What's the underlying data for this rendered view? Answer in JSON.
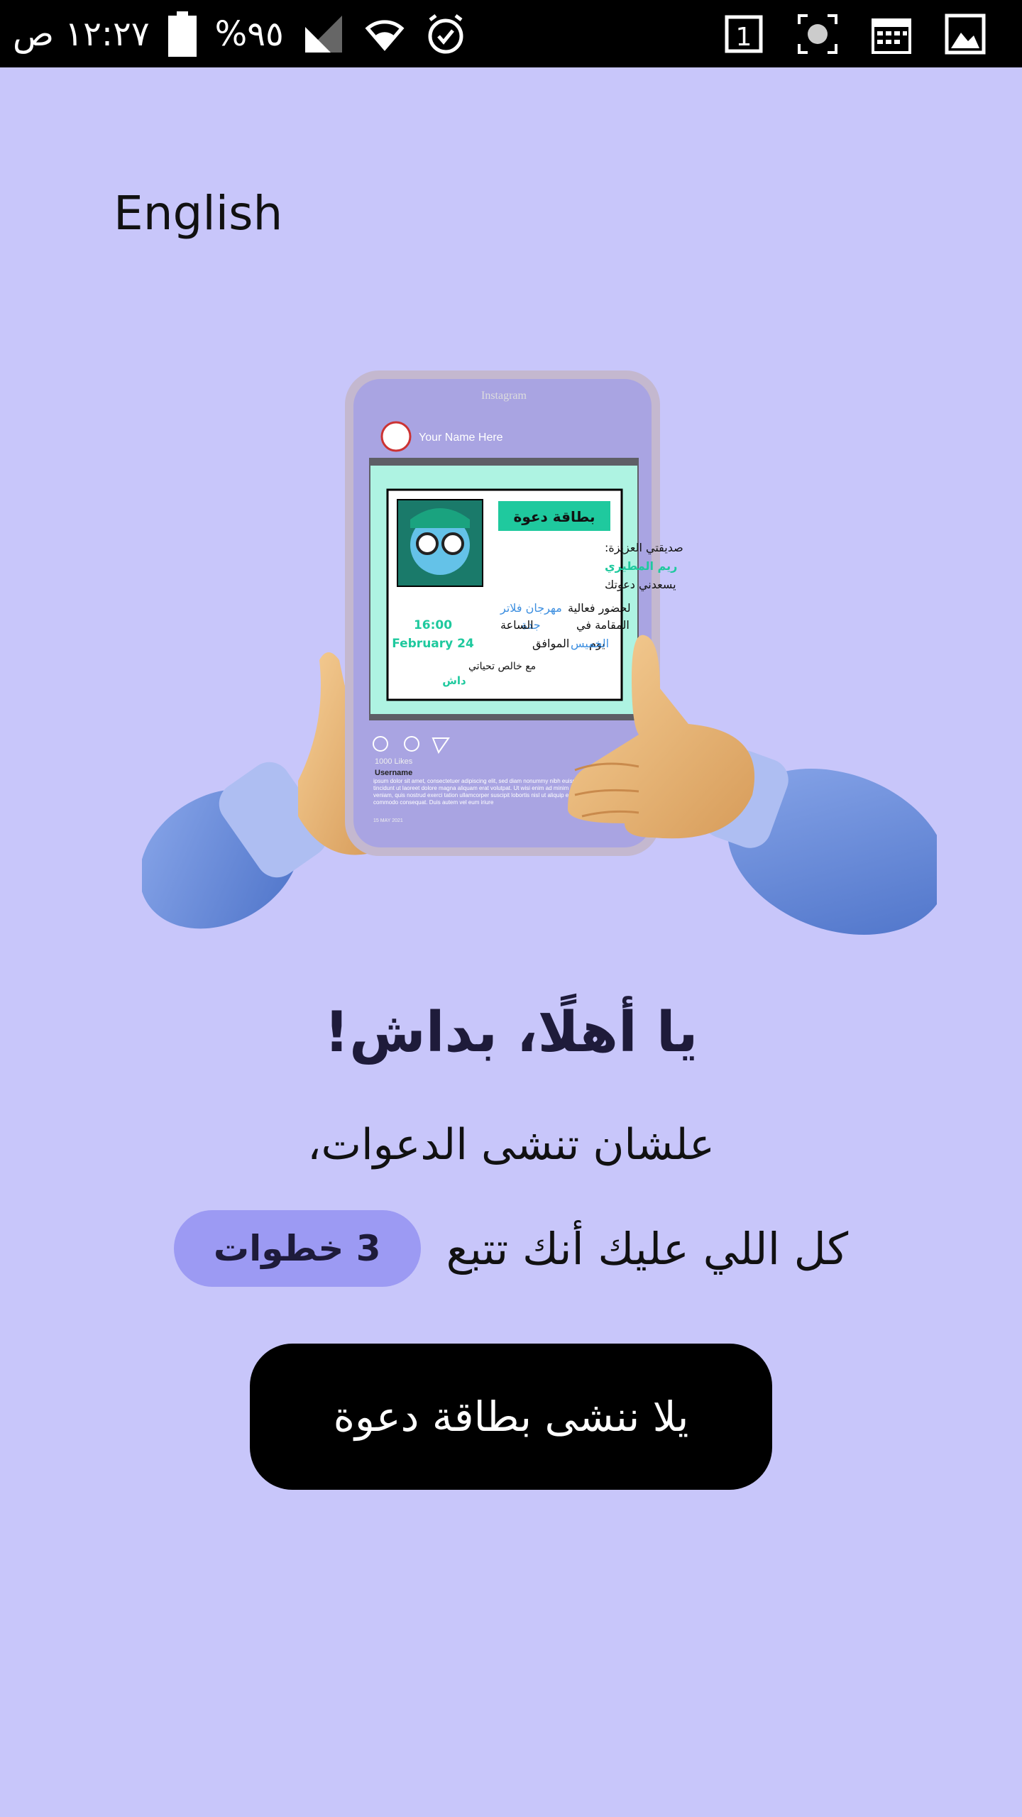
{
  "status_bar": {
    "time": "١٢:٢٧ ص",
    "battery": "%٩٥",
    "right_icons": [
      "sim-1-icon",
      "screenshot-icon",
      "calendar-icon",
      "gallery-icon"
    ]
  },
  "language_toggle": "English",
  "illustration": {
    "app_name": "Instagram",
    "profile_name": "Your Name Here",
    "card": {
      "title": "بطاقة دعوة",
      "greeting": "صديقتي العزيزة:",
      "name": "ريم المطيري",
      "line_pleased": "يسعدني دعوتك",
      "line_event_prefix": "لحضور فعالية",
      "event": "مهرجان فلاتر",
      "line_place_prefix": "المقامة في",
      "city": "جدة",
      "line_time_prefix": "الساعة",
      "time": "16:00",
      "line_day_prefix": "يوم",
      "day": "الخميس",
      "line_date_prefix": "الموافق",
      "date": "February 24",
      "regards": "مع خالص تحياتي",
      "signature": "داش"
    },
    "likes": "1000 Likes",
    "username": "Username",
    "caption": "ipsum dolor sit amet, consectetuer adipiscing elit, sed diam nonummy nibh euismod tincidunt ut laoreet dolore magna aliquam erat volutpat. Ut wisi enim ad minim veniam, quis nostrud exerci tation ullamcorper suscipit lobortis nisl ut aliquip ex ea commodo consequat. Duis autem vel eum iriure",
    "post_date": "15 MAY 2021"
  },
  "headline": "يا أهلًا، بداش!",
  "subline": "علشان تنشى الدعوات،",
  "steps_text": "كل اللي عليك أنك تتبع",
  "steps_badge": "3 خطوات",
  "cta_label": "يلا ننشى بطاقة دعوة",
  "colors": {
    "background": "#c8c6fa",
    "pill": "#9c9af3",
    "cta": "#000000",
    "card_accent": "#1fc99e",
    "card_link": "#3d8fe0"
  }
}
